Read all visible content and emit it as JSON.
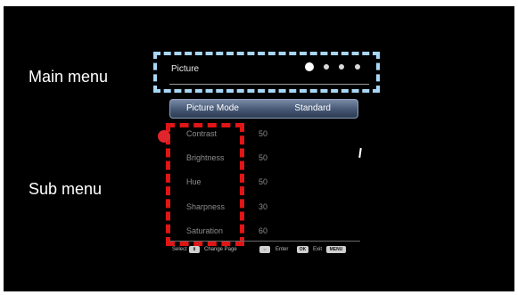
{
  "annotations": {
    "main_menu_label": "Main menu",
    "sub_menu_label": "Sub menu"
  },
  "osd": {
    "page_title": "Picture",
    "page_dot_count": 4,
    "page_current_index": 0,
    "selected_item": {
      "label": "Picture Mode",
      "value": "Standard"
    },
    "items": [
      {
        "label": "Contrast",
        "value": "50"
      },
      {
        "label": "Brightness",
        "value": "50"
      },
      {
        "label": "Hue",
        "value": "50"
      },
      {
        "label": "Sharpness",
        "value": "30"
      },
      {
        "label": "Saturation",
        "value": "60"
      }
    ],
    "footer": {
      "select_label": "Select",
      "change_page_label": "Change Page",
      "enter_label": "Enter",
      "enter_key": "OK",
      "exit_label": "Exit",
      "exit_key": "MENU"
    }
  },
  "colors": {
    "main_menu_box": "#a8d6f5",
    "sub_menu_box": "#e01515",
    "highlight_bar": "#455773"
  }
}
